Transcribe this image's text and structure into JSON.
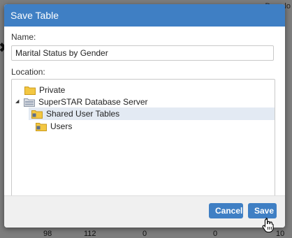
{
  "background": {
    "top_right_fragment": "Downlo",
    "row_values": [
      "98",
      "112",
      "0",
      "0",
      "10"
    ]
  },
  "dialog": {
    "title": "Save Table",
    "name_label": "Name:",
    "name_value": "Marital Status by Gender",
    "location_label": "Location:",
    "tree": [
      {
        "label": "Private",
        "icon": "folder-icon",
        "expanded": false
      },
      {
        "label": "SuperSTAR Database Server",
        "icon": "server-folder-icon",
        "expanded": true
      },
      {
        "label": "Shared User Tables",
        "icon": "shared-folder-icon",
        "selected": true
      },
      {
        "label": "Users",
        "icon": "shared-folder-icon",
        "selected": false
      }
    ],
    "buttons": {
      "cancel": "Cancel",
      "save": "Save"
    }
  },
  "colors": {
    "accent": "#3f7fc4",
    "selection": "#e3eaf3",
    "folder": "#f3c742"
  }
}
